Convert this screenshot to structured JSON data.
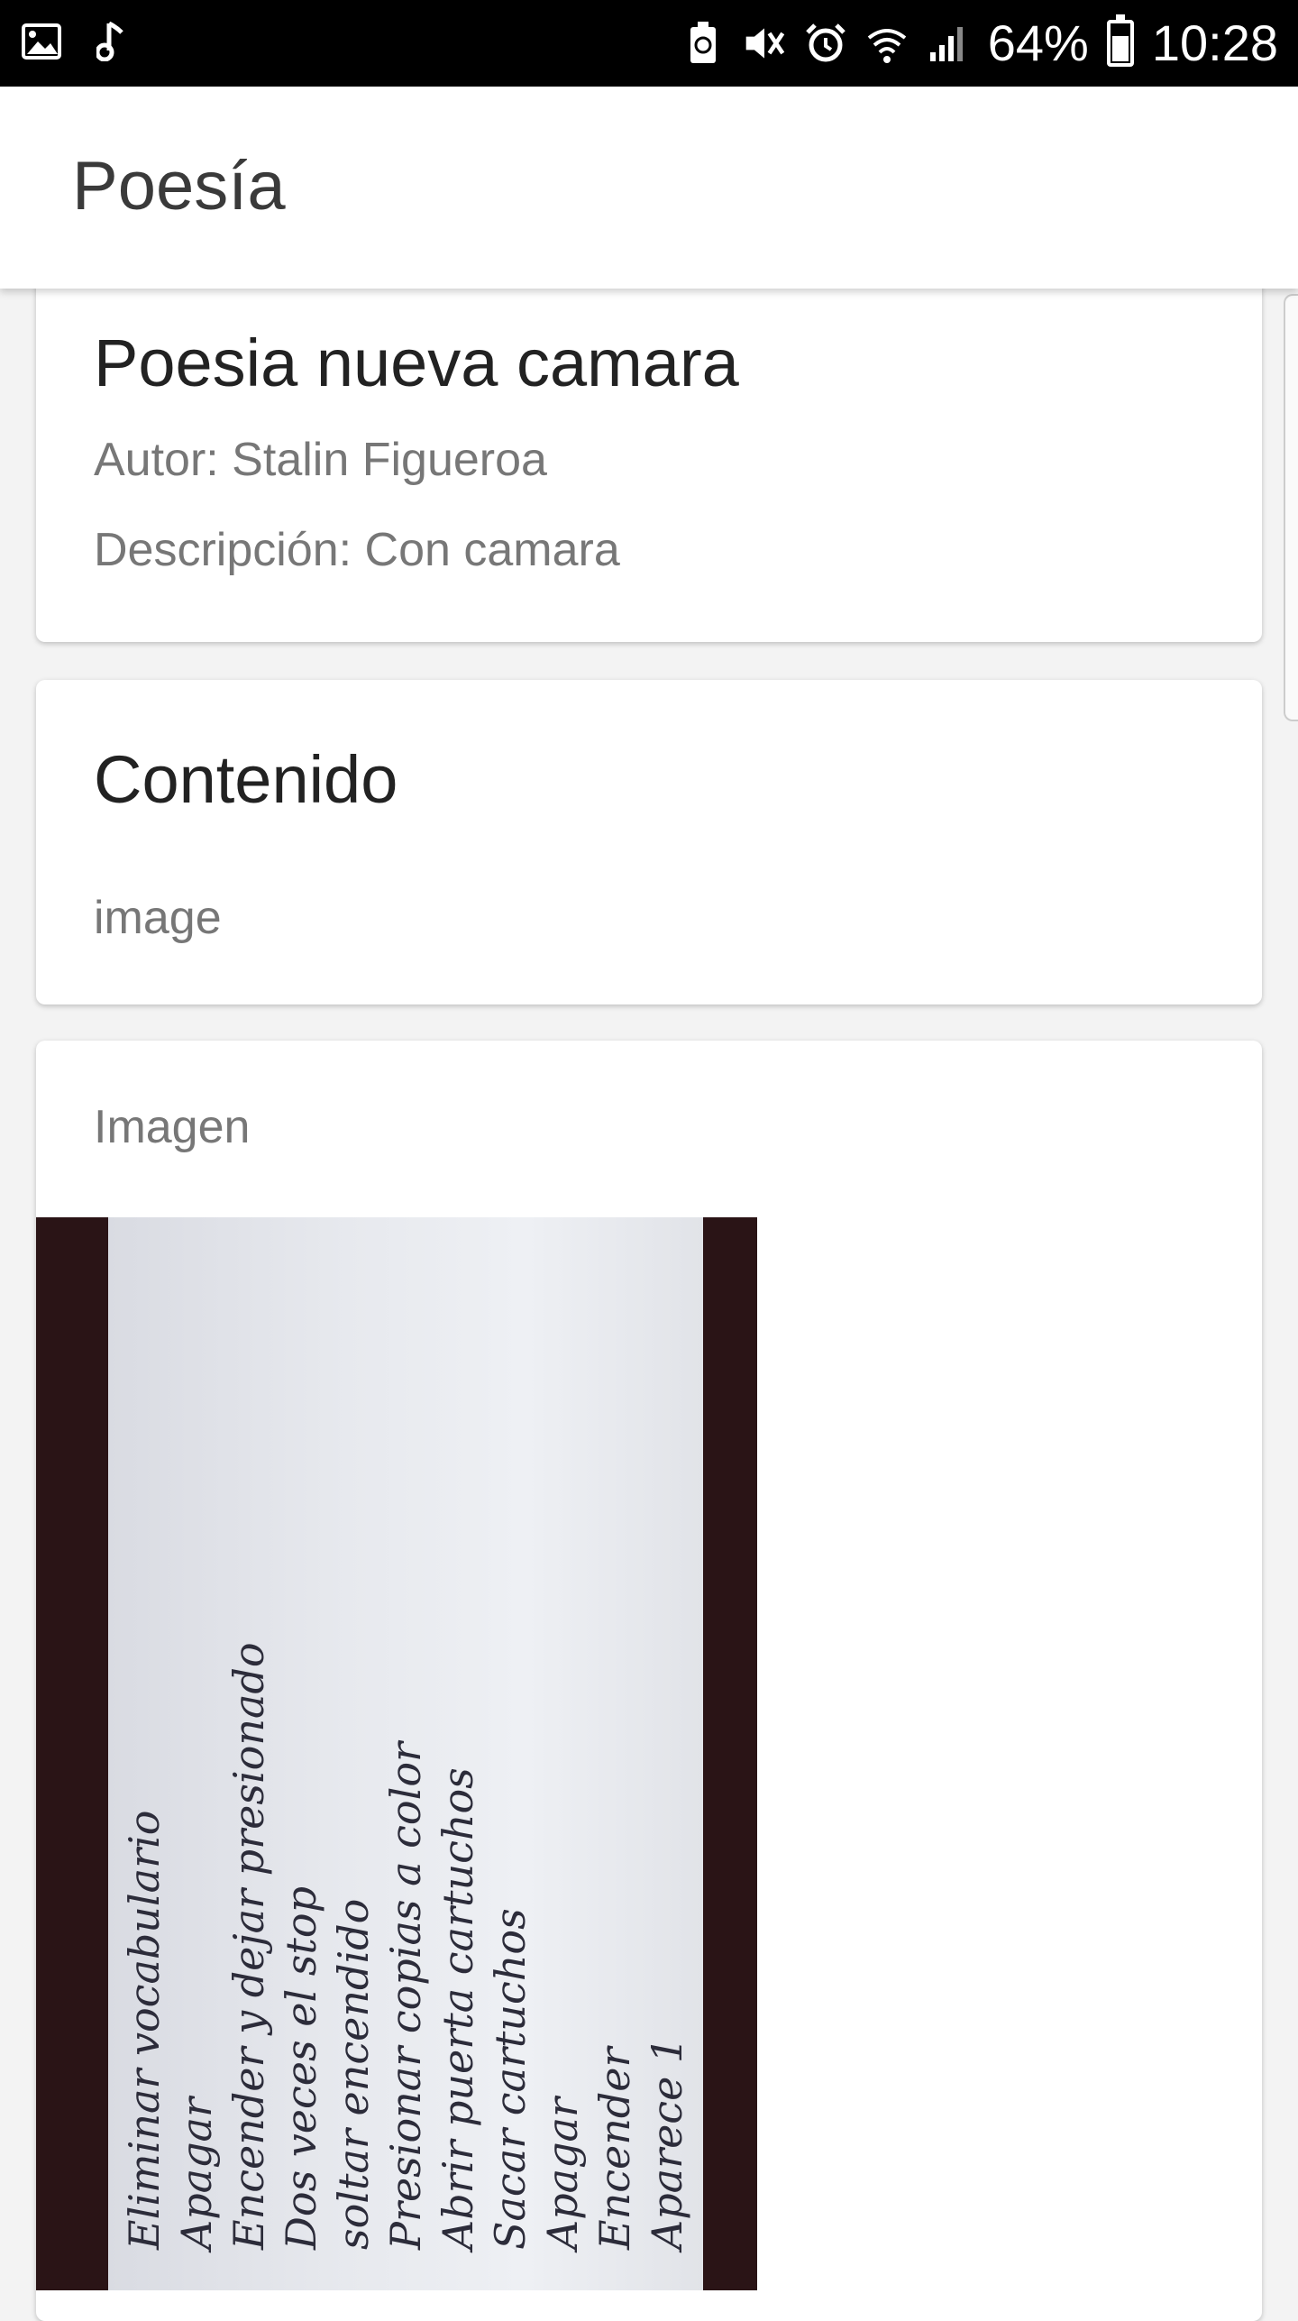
{
  "status_bar": {
    "icons_left": [
      "image-icon",
      "music-note-icon"
    ],
    "icons_right": [
      "battery-saver-icon",
      "mute-icon",
      "alarm-icon",
      "wifi-icon",
      "signal-icon"
    ],
    "battery_percent": "64%",
    "time": "10:28",
    "battery_level": 0.64
  },
  "app_bar": {
    "title": "Poesía"
  },
  "poem": {
    "title": "Poesia nueva camara",
    "author_line": "Autor: Stalin Figueroa",
    "description_line": "Descripción: Con camara"
  },
  "content": {
    "title": "Contenido",
    "text": "image"
  },
  "image_section": {
    "label": "Imagen",
    "handwritten": "Eliminar vocabulario\nApagar\nEncender y dejar presionado\nDos veces el stop\nsoltar encendido\nPresionar copias a color\nAbrir puerta cartuchos\nSacar cartuchos\nApagar\nEncender\nAparece 1"
  }
}
